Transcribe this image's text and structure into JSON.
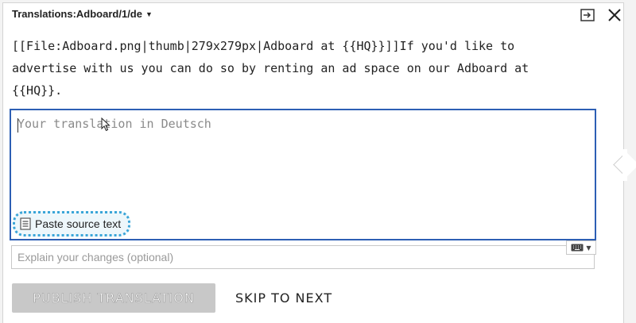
{
  "header": {
    "title": "Translations:Adboard/1/de",
    "dropdown_icon": "caret-down-icon",
    "actions": [
      {
        "name": "expand-icon"
      },
      {
        "name": "close-icon"
      }
    ]
  },
  "source": {
    "lines": [
      "[[File:Adboard.png|thumb|279x279px|Adboard at {{HQ}}]]If you'd like to",
      "advertise with us you can do so by renting an ad space on our Adboard at",
      "{{HQ}}."
    ]
  },
  "editor": {
    "placeholder": "Your translation in Deutsch",
    "value": "",
    "paste_label": "Paste source text",
    "paste_icon": "document-icon"
  },
  "summary": {
    "placeholder": "Explain your changes (optional)",
    "value": ""
  },
  "keyboard": {
    "icon": "keyboard-icon"
  },
  "buttons": {
    "publish": "PUBLISH TRANSLATION",
    "skip": "SKIP TO NEXT"
  },
  "colors": {
    "focus_border": "#2d5fb4",
    "highlight_ring": "#3aa5d8",
    "disabled_button": "#c8c8c8"
  }
}
